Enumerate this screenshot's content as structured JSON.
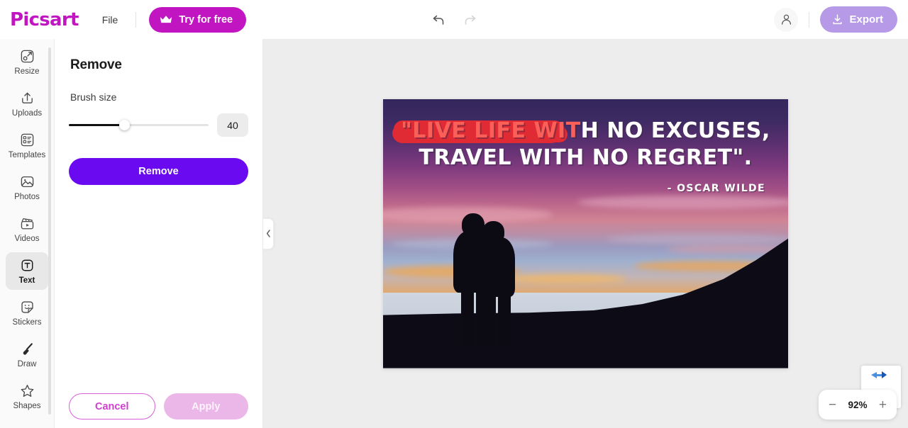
{
  "header": {
    "logo": "Picsart",
    "file_menu": "File",
    "try_free_label": "Try for free",
    "crown_icon": "crown-icon",
    "undo_icon": "undo-arrow-icon",
    "redo_icon": "redo-arrow-icon",
    "avatar_icon": "user-avatar-icon",
    "export_label": "Export",
    "export_icon": "download-icon",
    "colors": {
      "brand": "#c215c2",
      "export_bg": "#b69ae8"
    }
  },
  "sidebar": {
    "items": [
      {
        "label": "Resize",
        "icon": "resize-icon",
        "active": false
      },
      {
        "label": "Uploads",
        "icon": "upload-icon",
        "active": false
      },
      {
        "label": "Templates",
        "icon": "templates-icon",
        "active": false
      },
      {
        "label": "Photos",
        "icon": "photo-icon",
        "active": false
      },
      {
        "label": "Videos",
        "icon": "video-icon",
        "active": false
      },
      {
        "label": "Text",
        "icon": "text-icon",
        "active": true
      },
      {
        "label": "Stickers",
        "icon": "sticker-icon",
        "active": false
      },
      {
        "label": "Draw",
        "icon": "brush-icon",
        "active": false
      },
      {
        "label": "Shapes",
        "icon": "star-icon",
        "active": false
      }
    ]
  },
  "panel": {
    "title": "Remove",
    "brush_size_label": "Brush size",
    "brush_size_value": "40",
    "slider_percent": 40,
    "remove_button": "Remove",
    "cancel_button": "Cancel",
    "apply_button": "Apply",
    "collapse_icon": "chevron-left-icon",
    "colors": {
      "remove_bg": "#6a0af0",
      "cancel_border": "#d95fd9",
      "apply_bg": "#eab7e8"
    }
  },
  "canvas": {
    "quote_line1_highlight": "\"LIVE LIFE WIT",
    "quote_line1_rest": "H NO EXCUSES,",
    "quote_line2": "TRAVEL WITH NO REGRET\".",
    "attribution": "- OSCAR WILDE",
    "highlight_color": "#e02b34",
    "highlight_text_color": "#fb6058",
    "description": "sunset-hikers-silhouette-photo"
  },
  "zoom": {
    "minus_icon": "minus-icon",
    "value": "92%",
    "plus_icon": "plus-icon"
  },
  "recaptcha": {
    "icon": "recaptcha-badge-icon"
  }
}
